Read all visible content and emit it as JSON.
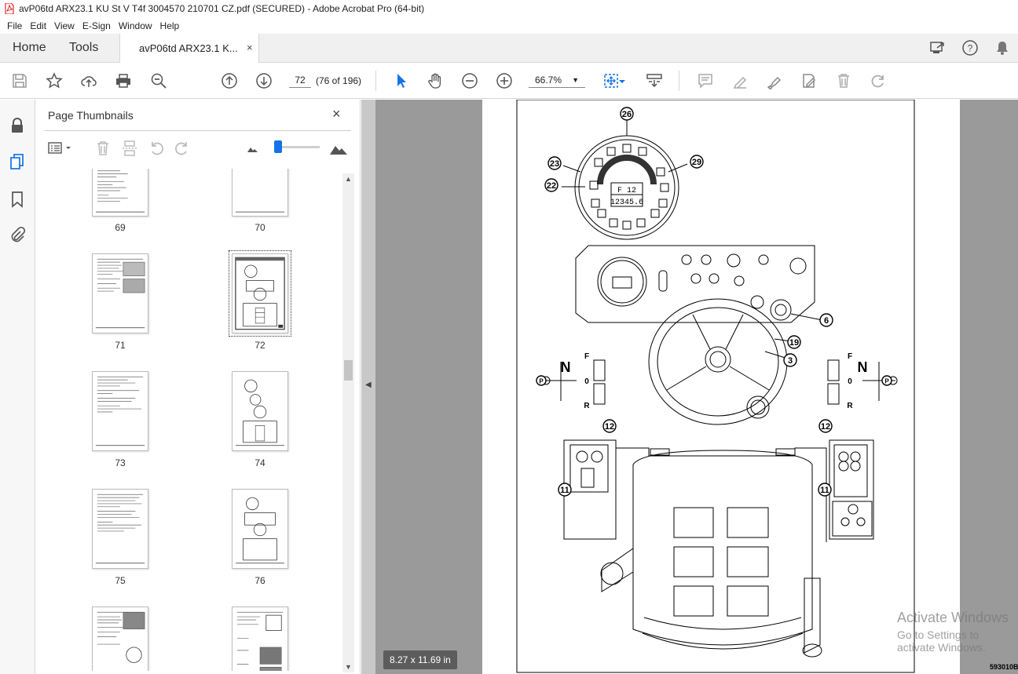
{
  "window": {
    "title": "avP06td ARX23.1 KU St V T4f 3004570 210701 CZ.pdf (SECURED) - Adobe Acrobat Pro (64-bit)"
  },
  "menu": [
    "File",
    "Edit",
    "View",
    "E-Sign",
    "Window",
    "Help"
  ],
  "tabs": {
    "home": "Home",
    "tools": "Tools",
    "doc": "avP06td ARX23.1 K...",
    "close": "×"
  },
  "toolbar": {
    "page_number": "72",
    "page_count": "(76 of 196)",
    "zoom": "66.7%"
  },
  "panel": {
    "title": "Page Thumbnails",
    "close": "×",
    "thumbnails": [
      {
        "label": "69"
      },
      {
        "label": "70"
      },
      {
        "label": "71"
      },
      {
        "label": "72",
        "selected": true
      },
      {
        "label": "73"
      },
      {
        "label": "74"
      },
      {
        "label": "75"
      },
      {
        "label": "76"
      }
    ]
  },
  "viewer": {
    "page_size": "8.27 x 11.69 in",
    "figure_code": "593010B",
    "callouts": [
      "26",
      "23",
      "29",
      "22",
      "6",
      "19",
      "3",
      "12",
      "11",
      "12",
      "11"
    ],
    "gear_labels": {
      "forward": "F",
      "neutral": "0",
      "reverse": "R",
      "n_left": "N",
      "n_right": "N",
      "p": "P"
    },
    "gauge_text": "F 12",
    "odometer": "12345.6"
  },
  "watermark": {
    "line1": "Activate Windows",
    "line2": "Go to Settings to activate Windows."
  }
}
